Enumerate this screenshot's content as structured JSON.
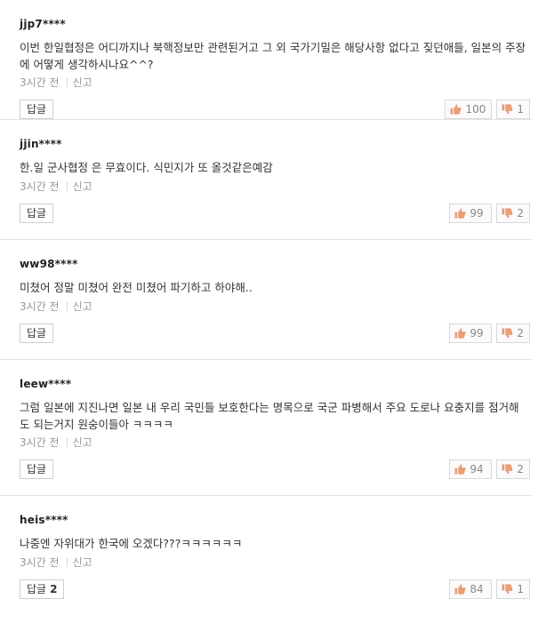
{
  "comments": [
    {
      "user": "jjp7****",
      "text": "이번 한일협정은 어디까지나 북핵정보만 관련된거고 그 외 국가기밀은 해당사항 없다고 짖던애들, 일본의 주장에 어떻게 생각하시나요^^?",
      "time": "3시간 전",
      "report": "신고",
      "reply_label": "답글",
      "reply_count": "",
      "likes": "100",
      "dislikes": "1"
    },
    {
      "user": "jjin****",
      "text": "한.일 군사협정 은 무효이다. 식민지가 또 올것같은예감",
      "time": "3시간 전",
      "report": "신고",
      "reply_label": "답글",
      "reply_count": "",
      "likes": "99",
      "dislikes": "2"
    },
    {
      "user": "ww98****",
      "text": "미쳤어 정말 미쳤어 완전 미쳤어 파기하고 하야해..",
      "time": "3시간 전",
      "report": "신고",
      "reply_label": "답글",
      "reply_count": "",
      "likes": "99",
      "dislikes": "2"
    },
    {
      "user": "leew****",
      "text": "그럼 일본에 지진나면 일본 내 우리 국민들 보호한다는 명목으로 국군 파병해서 주요 도로나 요충지를 점거해도 되는거지 원숭이들아 ㅋㅋㅋㅋ",
      "time": "3시간 전",
      "report": "신고",
      "reply_label": "답글",
      "reply_count": "",
      "likes": "94",
      "dislikes": "2"
    },
    {
      "user": "heis****",
      "text": "나중엔 자위대가 한국에 오겠다???ㅋㅋㅋㅋㅋㅋ",
      "time": "3시간 전",
      "report": "신고",
      "reply_label": "답글",
      "reply_count": "2",
      "likes": "84",
      "dislikes": "1"
    }
  ],
  "icons": {
    "like": "thumbs-up-icon",
    "dislike": "thumbs-down-icon",
    "like_color": "#e8a07a",
    "dislike_color": "#e8a07a"
  }
}
